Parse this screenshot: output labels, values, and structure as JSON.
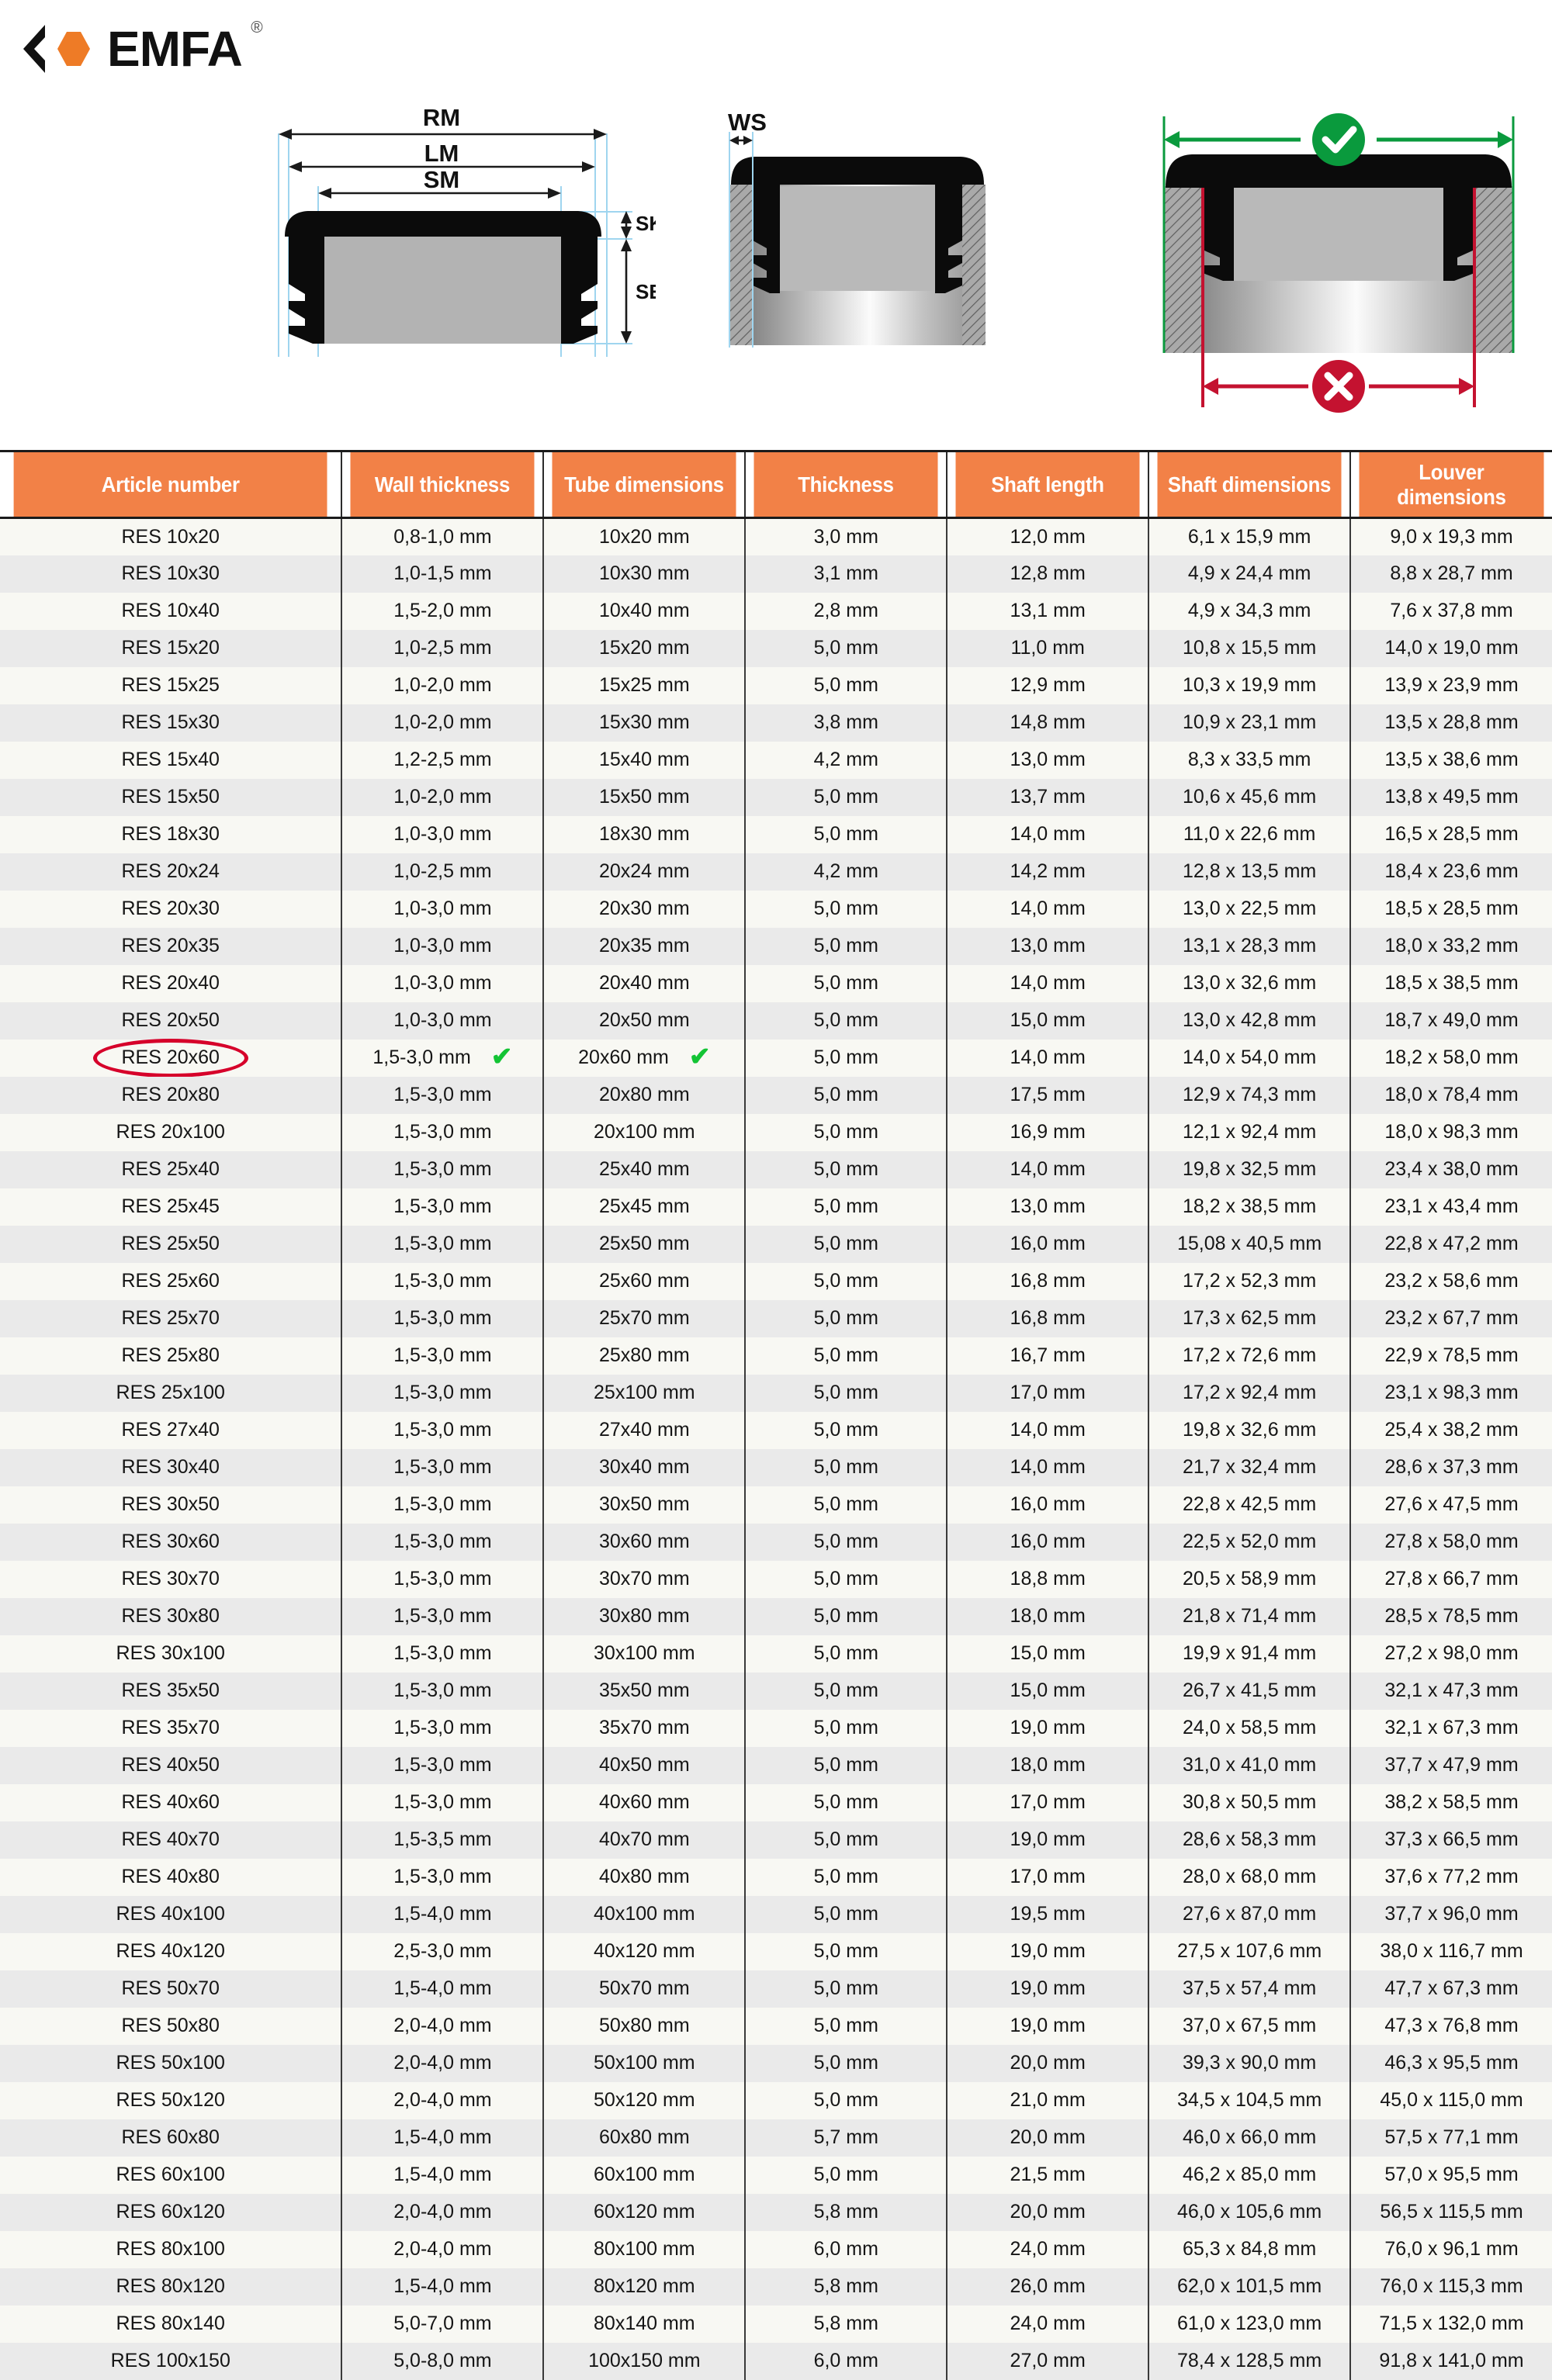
{
  "brand": {
    "name": "EMFA",
    "registered_symbol": "®",
    "logo_hex_color": "#EE7B26",
    "logo_chevron_color": "#111111"
  },
  "diagrams": [
    {
      "id": "plug-cross-section",
      "labels": [
        "RM",
        "LM",
        "SM",
        "SK",
        "SE"
      ],
      "description": "Tube plug cross-section with outer rim (RM), louver (LM), shaft (SM) widths and cap height (SK) and shaft length (SE)"
    },
    {
      "id": "plug-in-tube",
      "labels": [
        "WS"
      ],
      "description": "Plug inserted in tube showing wall thickness WS"
    },
    {
      "id": "fit-check",
      "labels": [],
      "status_ok": "check",
      "status_bad": "cross",
      "ok_color": "#0a9a3d",
      "bad_color": "#c41230",
      "description": "Correct outer measurement (green, check) versus incorrect inner measurement (red, cross)"
    }
  ],
  "table": {
    "columns": [
      "Article number",
      "Wall thickness",
      "Tube dimensions",
      "Thickness",
      "Shaft length",
      "Shaft dimensions",
      "Louver dimensions"
    ],
    "highlight": {
      "article": "RES 20x60",
      "ellipse_color": "#d6002a",
      "check_color": "#13c434",
      "checked_columns": [
        "Wall thickness",
        "Tube dimensions"
      ]
    },
    "rows": [
      [
        "RES 10x20",
        "0,8-1,0 mm",
        "10x20 mm",
        "3,0 mm",
        "12,0 mm",
        "6,1 x 15,9 mm",
        "9,0 x 19,3 mm"
      ],
      [
        "RES 10x30",
        "1,0-1,5 mm",
        "10x30 mm",
        "3,1 mm",
        "12,8 mm",
        "4,9 x 24,4 mm",
        "8,8 x 28,7 mm"
      ],
      [
        "RES 10x40",
        "1,5-2,0 mm",
        "10x40 mm",
        "2,8 mm",
        "13,1 mm",
        "4,9 x 34,3 mm",
        "7,6 x 37,8 mm"
      ],
      [
        "RES 15x20",
        "1,0-2,5 mm",
        "15x20 mm",
        "5,0 mm",
        "11,0 mm",
        "10,8 x 15,5 mm",
        "14,0 x 19,0 mm"
      ],
      [
        "RES 15x25",
        "1,0-2,0 mm",
        "15x25 mm",
        "5,0 mm",
        "12,9 mm",
        "10,3 x 19,9 mm",
        "13,9 x 23,9 mm"
      ],
      [
        "RES 15x30",
        "1,0-2,0 mm",
        "15x30 mm",
        "3,8 mm",
        "14,8 mm",
        "10,9 x 23,1 mm",
        "13,5 x 28,8 mm"
      ],
      [
        "RES 15x40",
        "1,2-2,5 mm",
        "15x40 mm",
        "4,2 mm",
        "13,0 mm",
        "8,3 x 33,5 mm",
        "13,5 x 38,6 mm"
      ],
      [
        "RES 15x50",
        "1,0-2,0 mm",
        "15x50 mm",
        "5,0 mm",
        "13,7 mm",
        "10,6 x 45,6 mm",
        "13,8 x 49,5 mm"
      ],
      [
        "RES 18x30",
        "1,0-3,0 mm",
        "18x30 mm",
        "5,0 mm",
        "14,0 mm",
        "11,0 x 22,6 mm",
        "16,5 x 28,5 mm"
      ],
      [
        "RES 20x24",
        "1,0-2,5 mm",
        "20x24 mm",
        "4,2 mm",
        "14,2 mm",
        "12,8 x 13,5 mm",
        "18,4 x 23,6 mm"
      ],
      [
        "RES 20x30",
        "1,0-3,0 mm",
        "20x30 mm",
        "5,0 mm",
        "14,0 mm",
        "13,0 x 22,5 mm",
        "18,5 x 28,5 mm"
      ],
      [
        "RES 20x35",
        "1,0-3,0 mm",
        "20x35 mm",
        "5,0 mm",
        "13,0 mm",
        "13,1 x 28,3 mm",
        "18,0 x 33,2 mm"
      ],
      [
        "RES 20x40",
        "1,0-3,0 mm",
        "20x40 mm",
        "5,0 mm",
        "14,0 mm",
        "13,0 x 32,6 mm",
        "18,5 x 38,5 mm"
      ],
      [
        "RES 20x50",
        "1,0-3,0 mm",
        "20x50 mm",
        "5,0 mm",
        "15,0 mm",
        "13,0 x 42,8 mm",
        "18,7 x 49,0 mm"
      ],
      [
        "RES 20x60",
        "1,5-3,0 mm",
        "20x60 mm",
        "5,0 mm",
        "14,0 mm",
        "14,0 x 54,0 mm",
        "18,2 x 58,0 mm"
      ],
      [
        "RES 20x80",
        "1,5-3,0 mm",
        "20x80 mm",
        "5,0 mm",
        "17,5 mm",
        "12,9 x 74,3 mm",
        "18,0 x 78,4 mm"
      ],
      [
        "RES 20x100",
        "1,5-3,0 mm",
        "20x100 mm",
        "5,0 mm",
        "16,9 mm",
        "12,1 x 92,4 mm",
        "18,0 x 98,3 mm"
      ],
      [
        "RES 25x40",
        "1,5-3,0 mm",
        "25x40 mm",
        "5,0 mm",
        "14,0 mm",
        "19,8 x 32,5 mm",
        "23,4 x 38,0 mm"
      ],
      [
        "RES 25x45",
        "1,5-3,0 mm",
        "25x45 mm",
        "5,0 mm",
        "13,0 mm",
        "18,2 x 38,5 mm",
        "23,1 x 43,4 mm"
      ],
      [
        "RES 25x50",
        "1,5-3,0 mm",
        "25x50 mm",
        "5,0 mm",
        "16,0 mm",
        "15,08 x 40,5 mm",
        "22,8 x 47,2 mm"
      ],
      [
        "RES 25x60",
        "1,5-3,0 mm",
        "25x60 mm",
        "5,0 mm",
        "16,8 mm",
        "17,2 x 52,3 mm",
        "23,2 x 58,6 mm"
      ],
      [
        "RES 25x70",
        "1,5-3,0 mm",
        "25x70 mm",
        "5,0 mm",
        "16,8 mm",
        "17,3 x 62,5 mm",
        "23,2 x 67,7 mm"
      ],
      [
        "RES 25x80",
        "1,5-3,0 mm",
        "25x80 mm",
        "5,0 mm",
        "16,7 mm",
        "17,2 x 72,6 mm",
        "22,9 x 78,5 mm"
      ],
      [
        "RES 25x100",
        "1,5-3,0 mm",
        "25x100 mm",
        "5,0 mm",
        "17,0 mm",
        "17,2 x 92,4 mm",
        "23,1 x 98,3 mm"
      ],
      [
        "RES 27x40",
        "1,5-3,0 mm",
        "27x40 mm",
        "5,0 mm",
        "14,0 mm",
        "19,8 x 32,6 mm",
        "25,4 x 38,2 mm"
      ],
      [
        "RES 30x40",
        "1,5-3,0 mm",
        "30x40 mm",
        "5,0 mm",
        "14,0 mm",
        "21,7 x 32,4 mm",
        "28,6 x 37,3 mm"
      ],
      [
        "RES 30x50",
        "1,5-3,0 mm",
        "30x50 mm",
        "5,0 mm",
        "16,0 mm",
        "22,8 x 42,5 mm",
        "27,6 x 47,5 mm"
      ],
      [
        "RES 30x60",
        "1,5-3,0 mm",
        "30x60 mm",
        "5,0 mm",
        "16,0 mm",
        "22,5 x 52,0 mm",
        "27,8 x 58,0 mm"
      ],
      [
        "RES 30x70",
        "1,5-3,0 mm",
        "30x70 mm",
        "5,0 mm",
        "18,8 mm",
        "20,5 x 58,9 mm",
        "27,8 x 66,7 mm"
      ],
      [
        "RES 30x80",
        "1,5-3,0 mm",
        "30x80 mm",
        "5,0 mm",
        "18,0 mm",
        "21,8 x 71,4 mm",
        "28,5 x 78,5 mm"
      ],
      [
        "RES 30x100",
        "1,5-3,0 mm",
        "30x100 mm",
        "5,0 mm",
        "15,0 mm",
        "19,9 x 91,4 mm",
        "27,2 x 98,0 mm"
      ],
      [
        "RES 35x50",
        "1,5-3,0 mm",
        "35x50 mm",
        "5,0 mm",
        "15,0 mm",
        "26,7 x 41,5 mm",
        "32,1 x 47,3 mm"
      ],
      [
        "RES 35x70",
        "1,5-3,0 mm",
        "35x70 mm",
        "5,0 mm",
        "19,0 mm",
        "24,0 x 58,5 mm",
        "32,1 x 67,3 mm"
      ],
      [
        "RES 40x50",
        "1,5-3,0 mm",
        "40x50 mm",
        "5,0 mm",
        "18,0 mm",
        "31,0 x 41,0 mm",
        "37,7 x 47,9 mm"
      ],
      [
        "RES 40x60",
        "1,5-3,0 mm",
        "40x60 mm",
        "5,0 mm",
        "17,0 mm",
        "30,8 x 50,5 mm",
        "38,2 x 58,5 mm"
      ],
      [
        "RES 40x70",
        "1,5-3,5 mm",
        "40x70 mm",
        "5,0 mm",
        "19,0 mm",
        "28,6 x 58,3 mm",
        "37,3 x 66,5 mm"
      ],
      [
        "RES 40x80",
        "1,5-3,0 mm",
        "40x80 mm",
        "5,0 mm",
        "17,0 mm",
        "28,0 x 68,0 mm",
        "37,6 x 77,2 mm"
      ],
      [
        "RES 40x100",
        "1,5-4,0 mm",
        "40x100 mm",
        "5,0 mm",
        "19,5 mm",
        "27,6 x 87,0 mm",
        "37,7 x 96,0 mm"
      ],
      [
        "RES 40x120",
        "2,5-3,0 mm",
        "40x120 mm",
        "5,0 mm",
        "19,0 mm",
        "27,5 x 107,6 mm",
        "38,0 x 116,7 mm"
      ],
      [
        "RES 50x70",
        "1,5-4,0 mm",
        "50x70 mm",
        "5,0 mm",
        "19,0 mm",
        "37,5 x 57,4 mm",
        "47,7 x 67,3 mm"
      ],
      [
        "RES 50x80",
        "2,0-4,0 mm",
        "50x80 mm",
        "5,0 mm",
        "19,0 mm",
        "37,0 x 67,5 mm",
        "47,3 x 76,8 mm"
      ],
      [
        "RES 50x100",
        "2,0-4,0 mm",
        "50x100 mm",
        "5,0 mm",
        "20,0 mm",
        "39,3 x 90,0 mm",
        "46,3 x 95,5 mm"
      ],
      [
        "RES 50x120",
        "2,0-4,0 mm",
        "50x120 mm",
        "5,0 mm",
        "21,0 mm",
        "34,5 x 104,5 mm",
        "45,0 x 115,0 mm"
      ],
      [
        "RES 60x80",
        "1,5-4,0 mm",
        "60x80 mm",
        "5,7 mm",
        "20,0 mm",
        "46,0 x 66,0 mm",
        "57,5 x 77,1 mm"
      ],
      [
        "RES 60x100",
        "1,5-4,0 mm",
        "60x100 mm",
        "5,0 mm",
        "21,5 mm",
        "46,2 x 85,0 mm",
        "57,0 x 95,5 mm"
      ],
      [
        "RES 60x120",
        "2,0-4,0 mm",
        "60x120 mm",
        "5,8 mm",
        "20,0 mm",
        "46,0 x 105,6 mm",
        "56,5 x 115,5 mm"
      ],
      [
        "RES 80x100",
        "2,0-4,0 mm",
        "80x100 mm",
        "6,0 mm",
        "24,0 mm",
        "65,3 x 84,8 mm",
        "76,0 x 96,1 mm"
      ],
      [
        "RES 80x120",
        "1,5-4,0 mm",
        "80x120 mm",
        "5,8 mm",
        "26,0 mm",
        "62,0 x 101,5 mm",
        "76,0 x 115,3 mm"
      ],
      [
        "RES 80x140",
        "5,0-7,0 mm",
        "80x140 mm",
        "5,8 mm",
        "24,0 mm",
        "61,0 x 123,0 mm",
        "71,5 x 132,0 mm"
      ],
      [
        "RES 100x150",
        "5,0-8,0 mm",
        "100x150 mm",
        "6,0 mm",
        "27,0 mm",
        "78,4 x 128,5 mm",
        "91,8 x 141,0 mm"
      ]
    ]
  }
}
